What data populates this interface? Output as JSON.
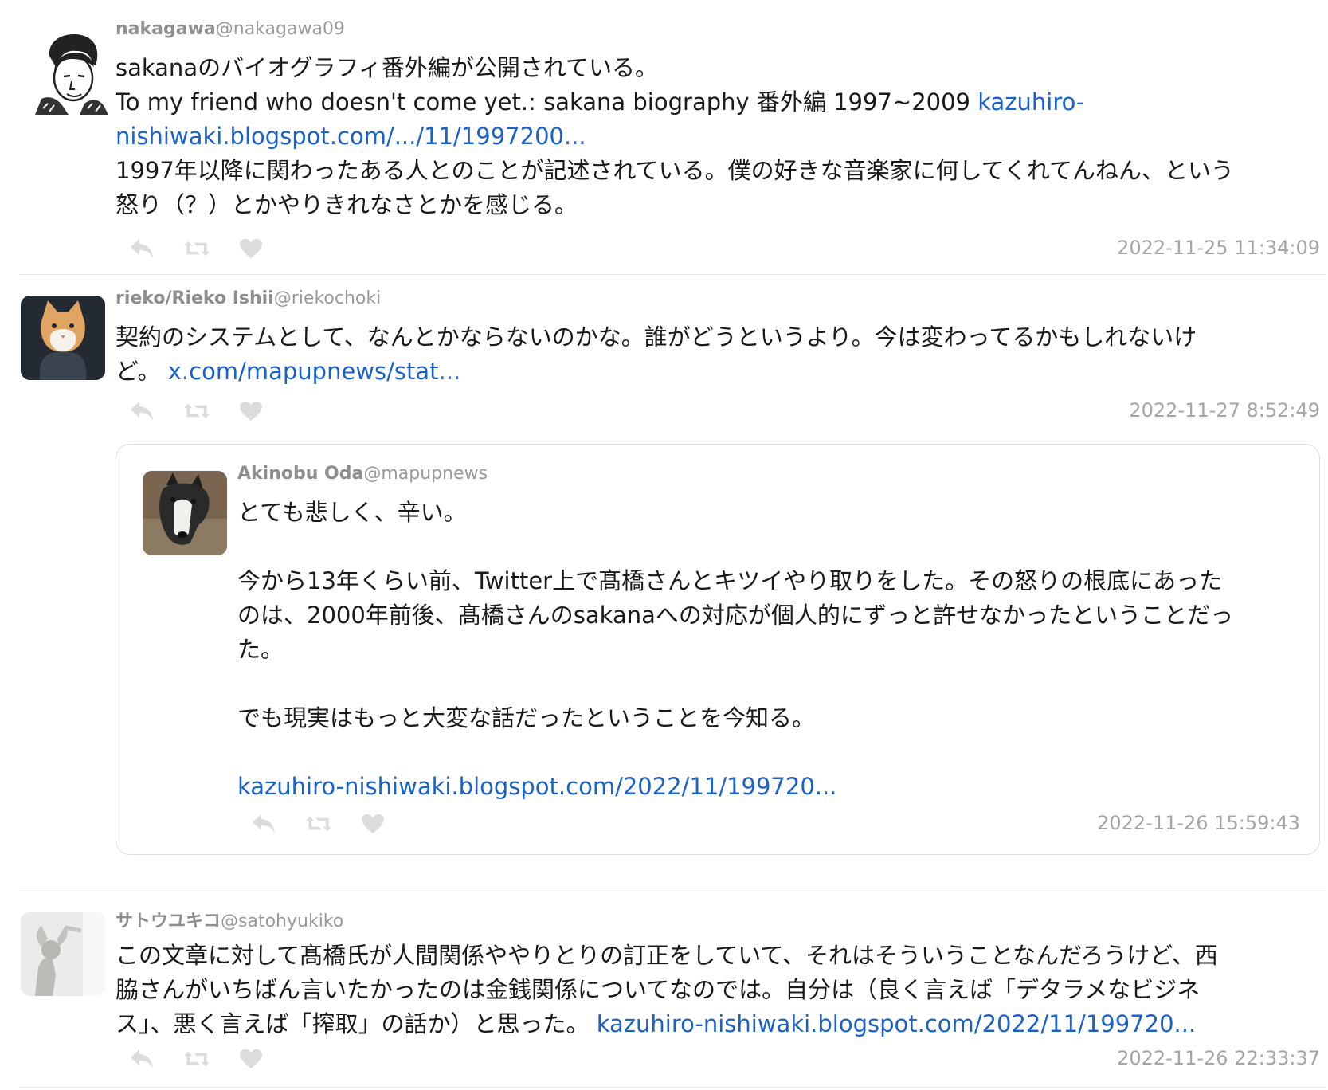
{
  "tweets": [
    {
      "user_name": "nakagawa",
      "handle": "@nakagawa09",
      "lines": [
        "sakanaのバイオグラフィ番外編が公開されている。",
        "To my friend who doesn't come yet.: sakana biography 番外編 1997~2009 ",
        "1997年以降に関わったある人とのことが記述されている。僕の好きな音楽家に何してくれてんねん、という",
        "怒り（？）とかやりきれなさとかを感じる。"
      ],
      "link_part1": "kazuhiro-",
      "link_part2": "nishiwaki.blogspot.com/.../11/1997200...",
      "timestamp": "2022-11-25 11:34:09"
    },
    {
      "user_name": "rieko/Rieko Ishii",
      "handle": "@riekochoki",
      "lines": [
        "契約のシステムとして、なんとかならないのかな。誰がどうというより。今は変わってるかもしれないけ",
        "ど。 "
      ],
      "link": "x.com/mapupnews/stat...",
      "timestamp": "2022-11-27 8:52:49",
      "quoted": {
        "user_name": "Akinobu Oda",
        "handle": "@mapupnews",
        "para1": "とても悲しく、辛い。",
        "para2_lines": [
          "今から13年くらい前、Twitter上で髙橋さんとキツイやり取りをした。その怒りの根底にあった",
          "のは、2000年前後、髙橋さんのsakanaへの対応が個人的にずっと許せなかったということだっ",
          "た。"
        ],
        "para3": "でも現実はもっと大変な話だったということを今知る。",
        "link": "kazuhiro-nishiwaki.blogspot.com/2022/11/199720...",
        "timestamp": "2022-11-26 15:59:43"
      }
    },
    {
      "user_name": "サトウユキコ",
      "handle": "@satohyukiko",
      "lines": [
        "この文章に対して髙橋氏が人間関係ややりとりの訂正をしていて、それはそういうことなんだろうけど、西",
        "脇さんがいちばん言いたかったのは金銭関係についてなのでは。自分は（良く言えば「デタラメなビジネ",
        "ス」、悪く言えば「搾取」の話か）と思った。 "
      ],
      "link": "kazuhiro-nishiwaki.blogspot.com/2022/11/199720...",
      "timestamp": "2022-11-26 22:33:37"
    }
  ],
  "icons": {
    "reply": "reply-icon",
    "retweet": "retweet-icon",
    "like": "heart-icon"
  },
  "colors": {
    "link": "#1a61c9",
    "meta": "#999999",
    "action_icon": "#dcdcdc",
    "separator": "#e3e3e3"
  }
}
